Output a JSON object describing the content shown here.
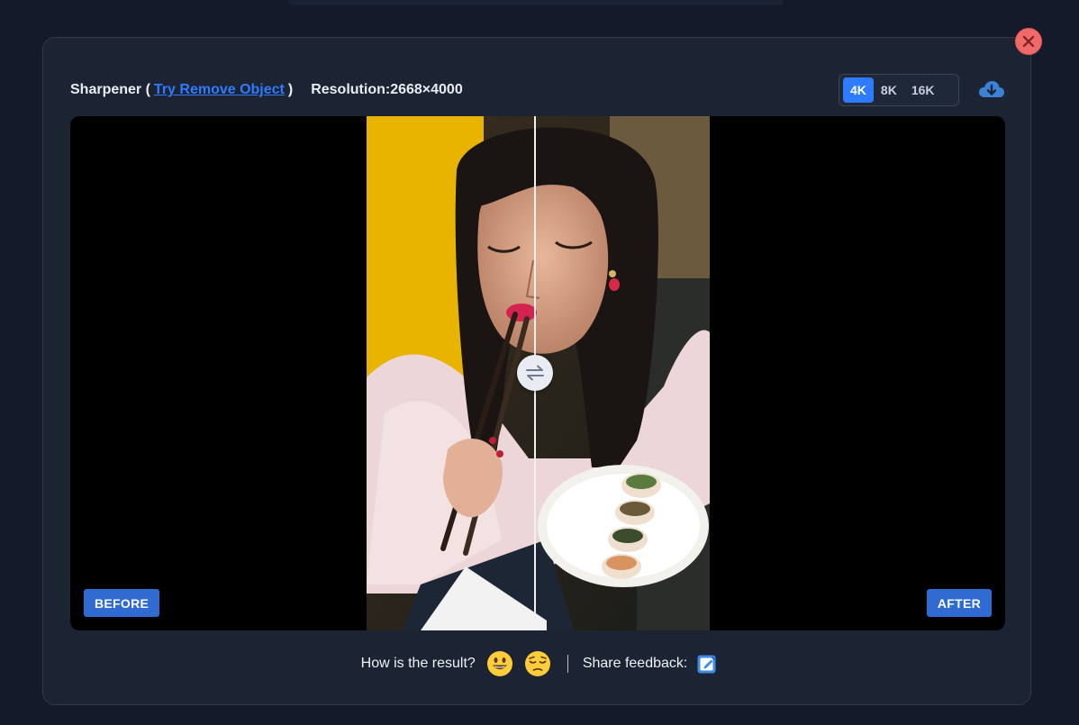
{
  "header": {
    "tool_name": "Sharpener (",
    "link_text": "Try Remove Object",
    "close_paren": ")",
    "resolution": "Resolution:2668×4000"
  },
  "resolution_options": [
    {
      "label": "4K",
      "selected": true
    },
    {
      "label": "8K",
      "selected": false
    },
    {
      "label": "16K",
      "selected": false
    }
  ],
  "icons": {
    "close": "close-icon",
    "download": "cloud-download-icon",
    "swap": "swap-arrows-icon",
    "happy": "grinning-face-icon",
    "sad": "pensive-face-icon",
    "feedback": "edit-note-icon"
  },
  "viewer": {
    "before_label": "BEFORE",
    "after_label": "AFTER"
  },
  "feedback": {
    "question": "How is the result?",
    "share": "Share feedback:"
  },
  "colors": {
    "accent": "#2f7bff",
    "close": "#f06a6a",
    "tag": "#2f6bd1"
  }
}
